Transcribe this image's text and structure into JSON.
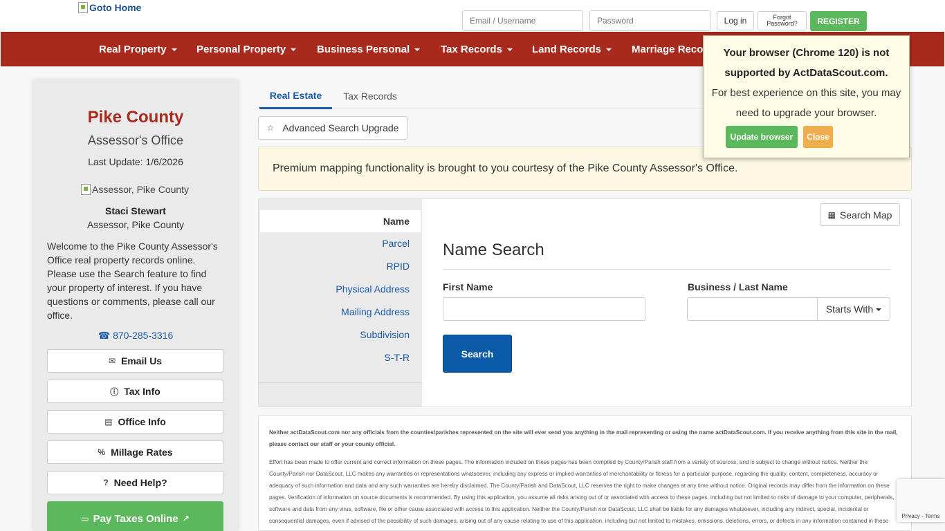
{
  "header": {
    "logo_alt": "Goto Home",
    "email_placeholder": "Email / Username",
    "password_placeholder": "Password",
    "login_label": "Log in",
    "forgot_label": "Forgot Password?",
    "register_label": "REGISTER"
  },
  "nav": {
    "items": [
      {
        "label": "Real Property"
      },
      {
        "label": "Personal Property"
      },
      {
        "label": "Business Personal"
      },
      {
        "label": "Tax Records"
      },
      {
        "label": "Land Records"
      },
      {
        "label": "Marriage Reco"
      }
    ]
  },
  "sidebar": {
    "county": "Pike County",
    "office": "Assessor's Office",
    "last_update": "Last Update: 1/6/2026",
    "image_alt": "Assessor, Pike County",
    "assessor_name": "Staci Stewart",
    "assessor_title": "Assessor, Pike County",
    "welcome": "Welcome to the Pike County Assessor's Office real property records online. Please use the Search feature to find your property of interest. If you have questions or comments, please call our office.",
    "phone": "870-285-3316",
    "buttons": [
      {
        "label": "Email Us",
        "icon": "envelope-icon"
      },
      {
        "label": "Tax Info",
        "icon": "info-icon"
      },
      {
        "label": "Office Info",
        "icon": "building-icon"
      },
      {
        "label": "Millage Rates",
        "icon": "percent-icon"
      },
      {
        "label": "Need Help?",
        "icon": "question-icon"
      }
    ],
    "pay_label": "Pay Taxes Online"
  },
  "main": {
    "tabs": [
      {
        "label": "Real Estate",
        "active": true
      },
      {
        "label": "Tax Records",
        "active": false
      }
    ],
    "advanced_label": "Advanced Search Upgrade",
    "banner": "Premium mapping functionality is brought to you courtesy of the Pike County Assessor's Office.",
    "search_tabs": [
      {
        "label": "Name",
        "active": true
      },
      {
        "label": "Parcel"
      },
      {
        "label": "RPID"
      },
      {
        "label": "Physical Address"
      },
      {
        "label": "Mailing Address"
      },
      {
        "label": "Subdivision"
      },
      {
        "label": "S-T-R"
      }
    ],
    "search_map_label": "Search Map",
    "search_title": "Name Search",
    "first_name_label": "First Name",
    "last_name_label": "Business / Last Name",
    "starts_with_label": "Starts With",
    "search_button": "Search"
  },
  "disclaimer": {
    "bold": "Neither actDataScout.com nor any officials from the counties/parishes represented on the site will ever send you anything in the mail representing or using the name actDataScout.com. If you receive anything from this site in the mail, please contact our staff or your county official.",
    "text": "Effort has been made to offer current and correct information on these pages. The information included on these pages has been compiled by County/Parish staff from a variety of sources, and is subject to change without notice. Neither the County/Parish nor DataScout, LLC makes any warranties or representations whatsoever, including any express or implied warranties of merchantability or fitness for a particular purpose, regarding the quality, content, completeness, accuracy or adequacy of such information and data and any such warranties are hereby disclaimed. The County/Parish and DataScout, LLC reserves the right to make changes at any time without notice. Original records may differ from the information on these pages. Verification of information on source documents is recommended. By using this application, you assume all risks arising out of or associated with access to these pages, including but not limited to risks of damage to your computer, peripherals, software and data from any virus, software, file or other cause associated with access to this application. Neither the County/Parish nor DataScout, LLC shall be liable for any damages whatsoever, including any indirect, special, incidental or consequential damages, even if advised of the possibility of such damages, arising out of any cause relating to use of this application, including but not limited to mistakes, omissions, deletions, errors, or defects in any information contained in these pages, or any failure to receive or delay in receiving information."
  },
  "popup": {
    "bold": "Your browser (Chrome 120) is not supported by ActDataScout.com.",
    "text": "For best experience on this site, you may need to upgrade your browser.",
    "update_label": "Update browser",
    "close_label": "Close"
  },
  "recaptcha": {
    "links": "Privacy - Terms"
  },
  "colors": {
    "brand_red": "#a82a1d",
    "link_blue": "#1a5aa8",
    "green": "#5cb85c",
    "orange": "#f0ad4e"
  }
}
